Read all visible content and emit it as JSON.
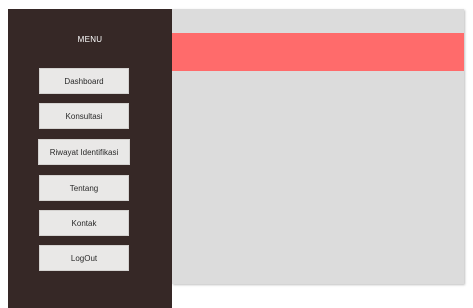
{
  "sidebar": {
    "title": "MENU",
    "items": [
      {
        "label": "Dashboard"
      },
      {
        "label": "Konsultasi"
      },
      {
        "label": "Riwayat Identifikasi"
      },
      {
        "label": "Tentang"
      },
      {
        "label": "Kontak"
      },
      {
        "label": "LogOut"
      }
    ]
  },
  "colors": {
    "sidebar_bg": "#362826",
    "header_bar": "#ff6b6b",
    "content_bg": "#dcdcdc",
    "button_bg": "#e9e8e7"
  }
}
